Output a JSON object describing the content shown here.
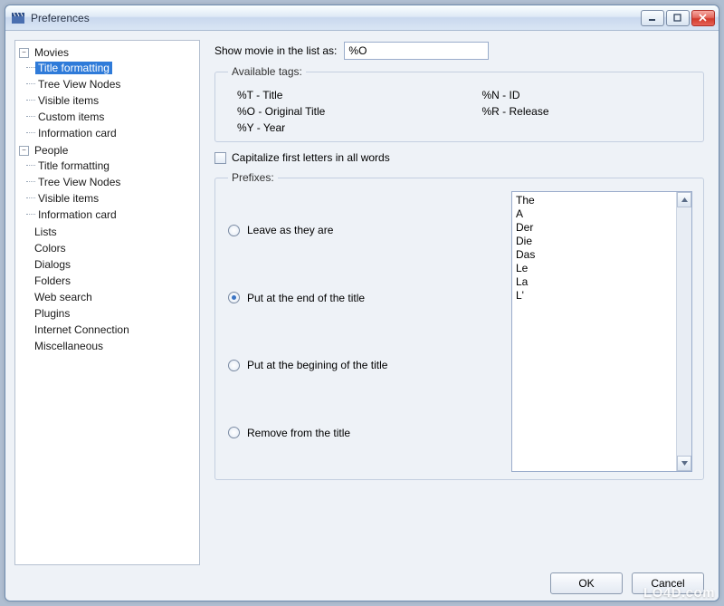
{
  "window": {
    "title": "Preferences"
  },
  "tree": {
    "movies": {
      "label": "Movies",
      "expander": "−",
      "children": [
        "Title formatting",
        "Tree View Nodes",
        "Visible items",
        "Custom items",
        "Information card"
      ]
    },
    "people": {
      "label": "People",
      "expander": "−",
      "children": [
        "Title formatting",
        "Tree View Nodes",
        "Visible items",
        "Information card"
      ]
    },
    "rest": [
      "Lists",
      "Colors",
      "Dialogs",
      "Folders",
      "Web search",
      "Plugins",
      "Internet Connection",
      "Miscellaneous"
    ]
  },
  "content": {
    "show_as_label": "Show movie in the list as:",
    "show_as_value": "%O",
    "tags_legend": "Available tags:",
    "tags": {
      "t": "%T - Title",
      "n": "%N - ID",
      "o": "%O - Original Title",
      "r": "%R - Release",
      "y": "%Y - Year"
    },
    "capitalize_label": "Capitalize first letters in all words",
    "prefixes_legend": "Prefixes:",
    "radios": {
      "leave": "Leave as they are",
      "end": "Put at the end of the title",
      "begin": "Put at the begining of the title",
      "remove": "Remove from the title"
    },
    "prefix_list": [
      "The",
      "A",
      "Der",
      "Die",
      "Das",
      "Le",
      "La",
      "L'"
    ]
  },
  "footer": {
    "ok": "OK",
    "cancel": "Cancel"
  },
  "watermark": "LO4D.com"
}
